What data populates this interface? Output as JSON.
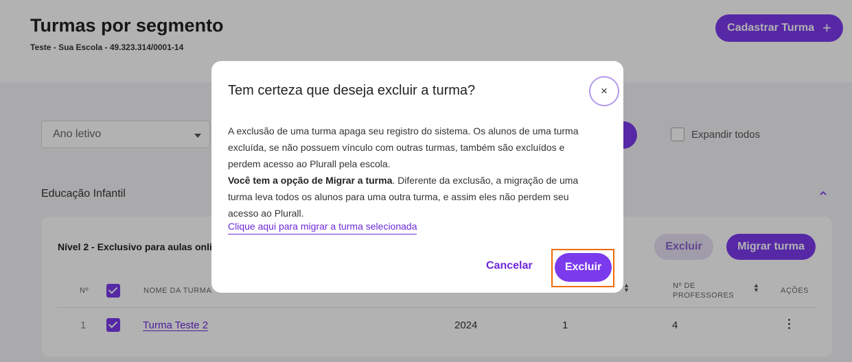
{
  "header": {
    "title": "Turmas por segmento",
    "subtitle": "Teste - Sua Escola - 49.323.314/0001-14",
    "cadastrar_label": "Cadastrar Turma",
    "cadastrar_icon": "+"
  },
  "filters": {
    "ano_letivo_placeholder": "Ano letivo",
    "expand_label": "Expandir todos"
  },
  "section": {
    "title": "Educação Infantil"
  },
  "card": {
    "level_title": "Nível 2 - Exclusivo para aulas onlin",
    "excluir_label": "Excluir",
    "migrar_label": "Migrar turma"
  },
  "table": {
    "headers": {
      "num": "Nº",
      "nome": "NOME DA TURMA",
      "professores_line1": "Nº DE",
      "professores_line2": "PROFESSORES",
      "acoes": "AÇÕES"
    },
    "rows": [
      {
        "num": "1",
        "nome": "Turma Teste 2",
        "ano": "2024",
        "alunos": "1",
        "professores": "4"
      }
    ]
  },
  "modal": {
    "title": "Tem certeza que deseja excluir a turma?",
    "close_icon": "×",
    "paragraph1": "A exclusão de uma turma apaga seu registro do sistema. Os alunos de uma turma excluída, se não possuem vínculo com outras turmas, também são excluídos e perdem acesso ao Plurall pela escola.",
    "paragraph2_bold": "Você tem a opção de Migrar a turma",
    "paragraph2_rest": ". Diferente da exclusão, a migração de uma turma leva todos os alunos para uma outra turma, e assim eles não perdem seu acesso ao Plurall.",
    "migrate_link": "Clique aqui para migrar a turma selecionada",
    "cancel_label": "Cancelar",
    "confirm_label": "Excluir"
  },
  "colors": {
    "accent": "#7c3aed",
    "highlight": "#f06a00"
  }
}
